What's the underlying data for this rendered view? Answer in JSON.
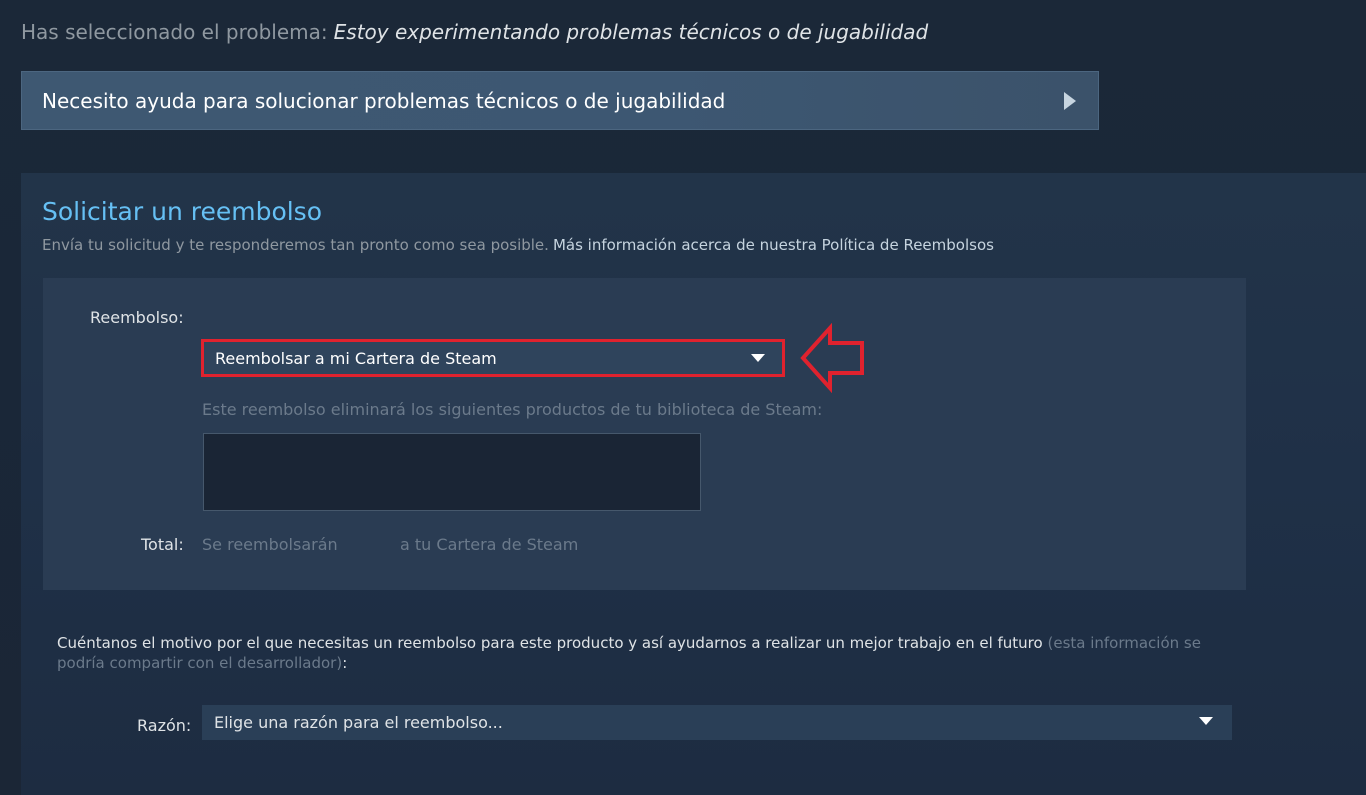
{
  "problem": {
    "prefix": "Has seleccionado el problema:",
    "value": "Estoy experimentando problemas técnicos o de jugabilidad"
  },
  "help_button": {
    "label": "Necesito ayuda para solucionar problemas técnicos o de jugabilidad",
    "icon": "play-arrow-icon"
  },
  "refund_section": {
    "title": "Solicitar un reembolso",
    "description": "Envía tu solicitud y te responderemos tan pronto como sea posible.",
    "policy_link": "Más información acerca de nuestra Política de Reembolsos",
    "refund_label": "Reembolso:",
    "refund_select_value": "Reembolsar a mi Cartera de Steam",
    "remove_note": "Este reembolso eliminará los siguientes productos de tu biblioteca de Steam:",
    "total_label": "Total:",
    "total_part1": "Se reembolsarán",
    "total_part2": "a tu Cartera de Steam"
  },
  "reason_section": {
    "intro": "Cuéntanos el motivo por el que necesitas un reembolso para este producto y así ayudarnos a realizar un mejor trabajo en el futuro",
    "intro_note": "(esta información se podría compartir con el desarrollador)",
    "intro_end": ":",
    "reason_label": "Razón:",
    "reason_select_value": "Elige una razón para el reembolso..."
  },
  "colors": {
    "accent": "#66c0f4",
    "highlight": "#e0222e",
    "background": "#1b2838"
  }
}
